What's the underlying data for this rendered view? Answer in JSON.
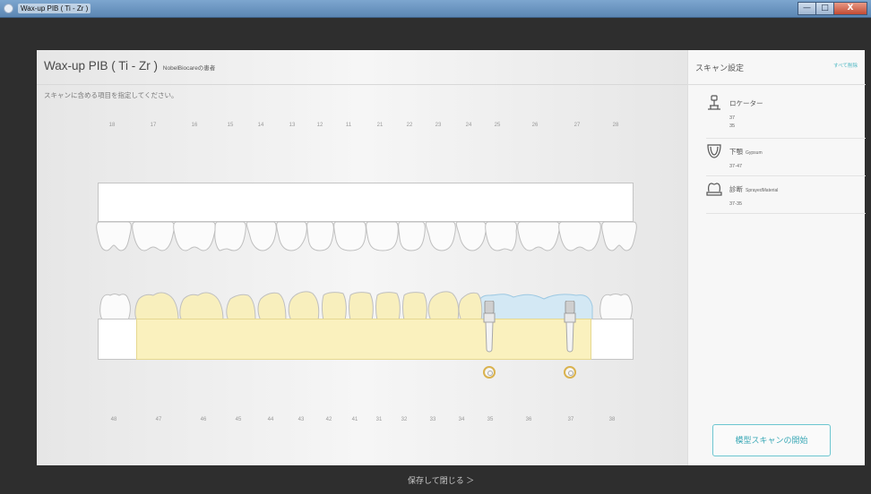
{
  "window": {
    "title": "Wax-up PIB ( Ti - Zr )",
    "buttons": [
      "—",
      "□",
      "X"
    ]
  },
  "header": {
    "title": "Wax-up PIB ( Ti - Zr )",
    "subtitle": "NobelBiocareの患者"
  },
  "instruction": "スキャンに含める項目を指定してください。",
  "upper_teeth_numbers": [
    "18",
    "17",
    "16",
    "15",
    "14",
    "13",
    "12",
    "11",
    "21",
    "22",
    "23",
    "24",
    "25",
    "26",
    "27",
    "28"
  ],
  "lower_teeth_numbers": [
    "48",
    "47",
    "46",
    "45",
    "44",
    "43",
    "42",
    "41",
    "31",
    "32",
    "33",
    "34",
    "35",
    "36",
    "37",
    "38"
  ],
  "scan_settings": {
    "title": "スキャン設定",
    "clear_all": "すべて削除",
    "items": [
      {
        "name": "ロケーター",
        "material": "",
        "values": [
          "37",
          "35"
        ],
        "icon": "locator-icon"
      },
      {
        "name": "下顎",
        "material": "Gypsum",
        "values": [
          "37-47"
        ],
        "icon": "lower-jaw-icon"
      },
      {
        "name": "診断",
        "material": "SprayedMaterial",
        "values": [
          "37-35"
        ],
        "icon": "diagnostic-icon"
      }
    ]
  },
  "start_button": "模型スキャンの開始",
  "save_close": "保存して閉じる ＞",
  "colors": {
    "accent": "#4bb6c2",
    "selection_yellow": "#f9eeb0",
    "selection_blue": "#cfe6f3"
  }
}
